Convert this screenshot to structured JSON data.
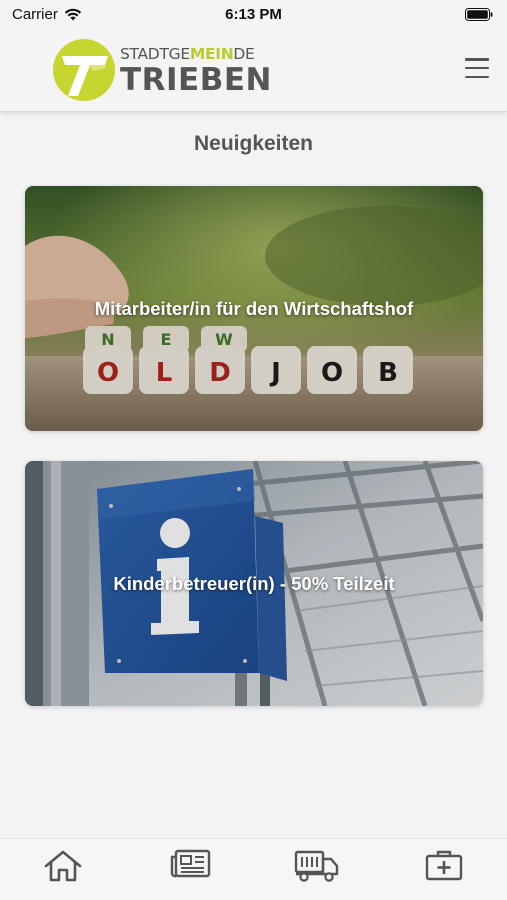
{
  "status_bar": {
    "carrier": "Carrier",
    "time": "6:13 PM"
  },
  "header": {
    "logo_line1_prefix": "STADTGE",
    "logo_line1_highlight": "MEIN",
    "logo_line1_suffix": "DE",
    "logo_line2": "TRIEBEN",
    "accent_color": "#c6d530",
    "menu_icon": "hamburger-menu-icon"
  },
  "main": {
    "title": "Neuigkeiten",
    "news": [
      {
        "title": "Mitarbeiter/in für den Wirtschaftshof",
        "image": "new-old-job-dice-photo"
      },
      {
        "title": "Kinderbetreuer(in) - 50% Teilzeit",
        "image": "information-sign-photo"
      }
    ]
  },
  "tab_bar": {
    "tabs": [
      {
        "icon": "home-icon"
      },
      {
        "icon": "newspaper-icon"
      },
      {
        "icon": "truck-icon"
      },
      {
        "icon": "medical-kit-icon"
      }
    ]
  }
}
